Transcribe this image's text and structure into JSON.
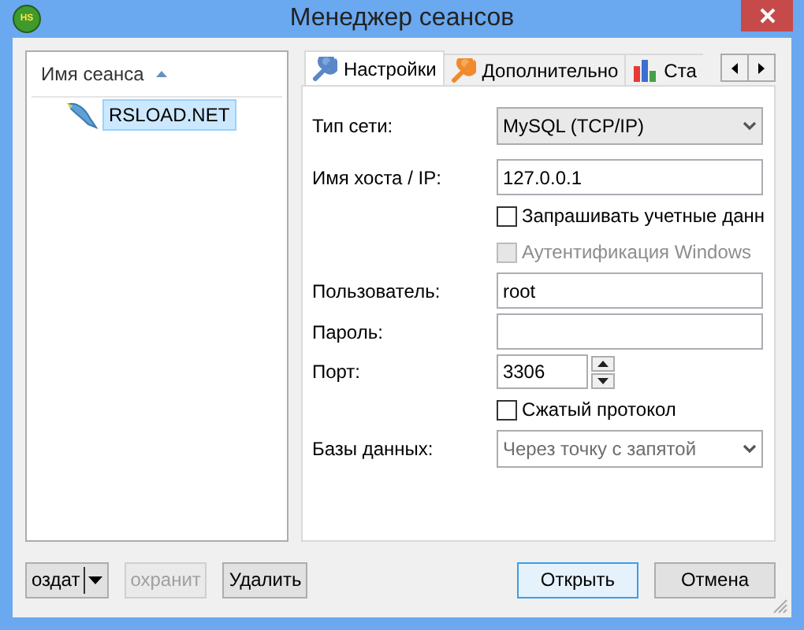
{
  "window": {
    "title": "Менеджер сеансов",
    "logo": "HS"
  },
  "session_list": {
    "header": "Имя сеанса",
    "items": [
      {
        "name": "RSLOAD.NET",
        "selected": true
      }
    ]
  },
  "tabs": [
    {
      "label": "Настройки",
      "selected": true
    },
    {
      "label": "Дополнительно",
      "selected": false
    },
    {
      "label": "Ста",
      "selected": false
    }
  ],
  "settings": [
    {
      "kind": "select",
      "label": "Тип сети:",
      "value": "MySQL (TCP/IP)"
    },
    {
      "kind": "text",
      "label": "Имя хоста / IP:",
      "value": "127.0.0.1"
    },
    {
      "kind": "checkbox",
      "text": "Запрашивать учетные данн",
      "checked": false,
      "disabled": false
    },
    {
      "kind": "checkbox",
      "text": "Аутентификация Windows",
      "checked": false,
      "disabled": true
    },
    {
      "kind": "text",
      "label": "Пользователь:",
      "value": "root"
    },
    {
      "kind": "text",
      "label": "Пароль:"
    },
    {
      "kind": "spin",
      "label": "Порт:",
      "value": "3306"
    },
    {
      "kind": "checkbox",
      "text": "Сжатый протокол",
      "checked": false,
      "disabled": false
    },
    {
      "kind": "select",
      "label": "Базы данных:",
      "placeholder": "Через точку с запятой"
    }
  ],
  "left_buttons": [
    {
      "label": "оздат",
      "split": true,
      "disabled": false
    },
    {
      "label": "охранит",
      "split": false,
      "disabled": true
    },
    {
      "label": "Удалить",
      "split": false,
      "disabled": false
    }
  ],
  "right_buttons": [
    {
      "label": "Открыть",
      "default": true
    },
    {
      "label": "Отмена",
      "default": false
    }
  ]
}
